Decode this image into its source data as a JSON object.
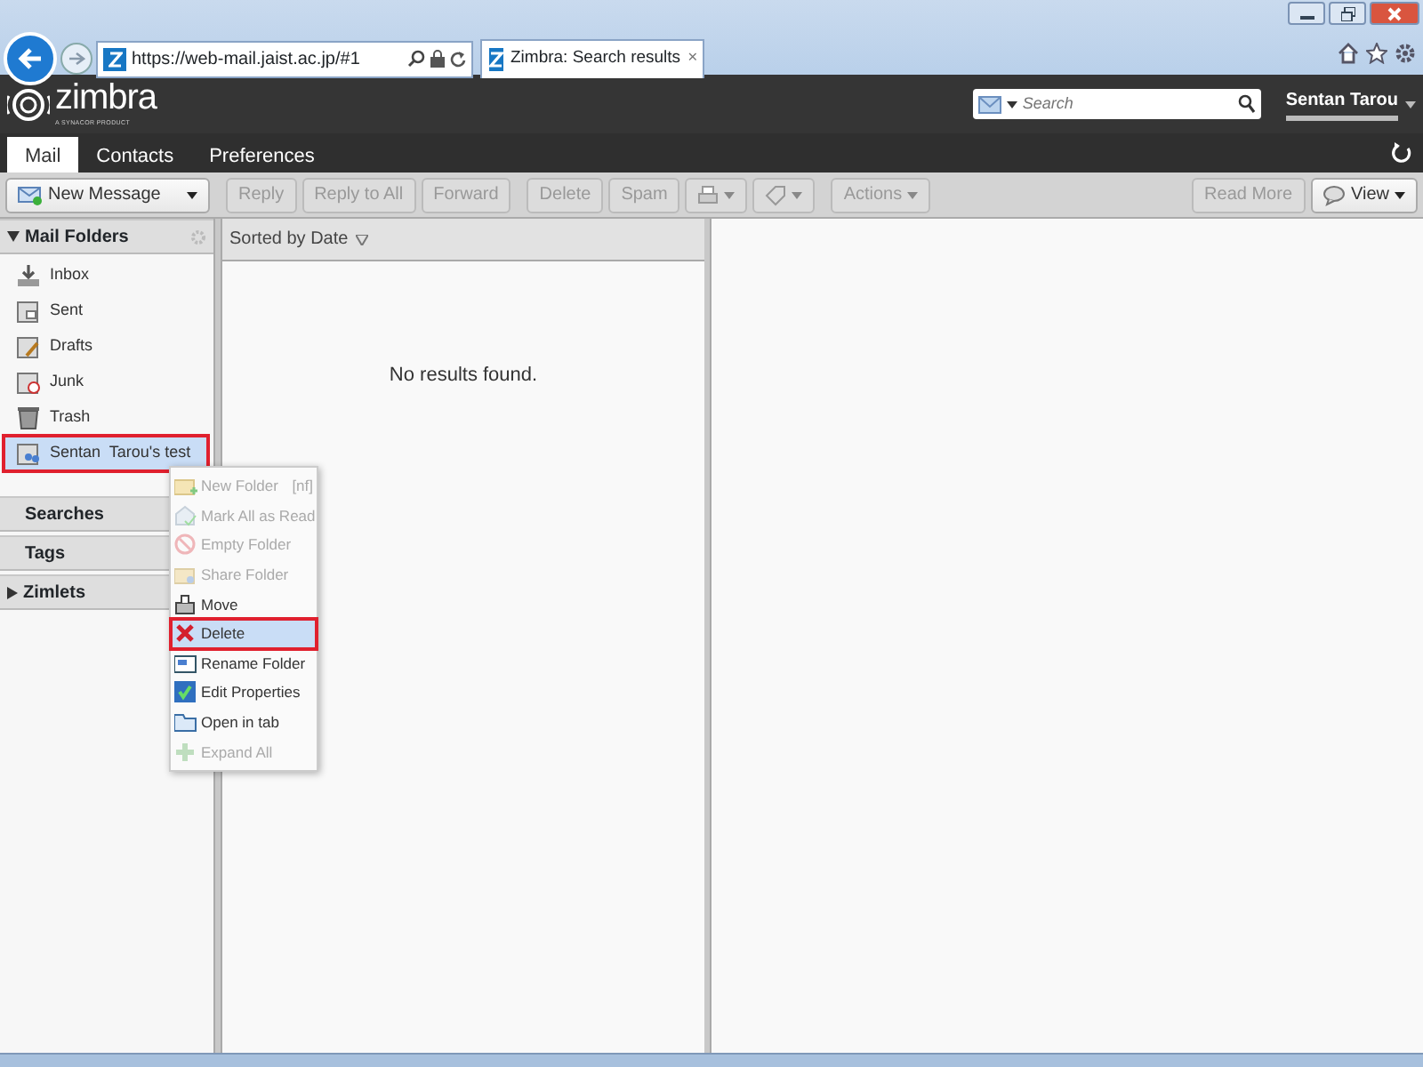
{
  "browser": {
    "address": "https://web-mail.jaist.ac.jp/#1",
    "tab_title": "Zimbra: Search results",
    "tab_close": "×"
  },
  "header": {
    "logo": "zimbra",
    "logo_sub": "A SYNACOR PRODUCT",
    "search_placeholder": "Search",
    "user": "Sentan Tarou"
  },
  "app_tabs": [
    {
      "label": "Mail",
      "selected": true
    },
    {
      "label": "Contacts",
      "selected": false
    },
    {
      "label": "Preferences",
      "selected": false
    }
  ],
  "toolbar": {
    "left": [
      {
        "label": "New Message",
        "kind": "menu",
        "disabled": false
      },
      {
        "label": "Reply",
        "kind": "plain",
        "disabled": true
      },
      {
        "label": "Reply to All",
        "kind": "plain",
        "disabled": true
      },
      {
        "label": "Forward",
        "kind": "plain",
        "disabled": true
      },
      {
        "label": "Delete",
        "kind": "plain",
        "disabled": true
      },
      {
        "label": "Spam",
        "kind": "plain",
        "disabled": true
      },
      {
        "kind": "iconmenu",
        "disabled": true
      },
      {
        "kind": "iconmenu",
        "disabled": true
      },
      {
        "label": "Actions",
        "kind": "menu",
        "disabled": true
      }
    ],
    "right": [
      {
        "label": "Read More",
        "kind": "plain",
        "disabled": true
      },
      {
        "label": "View",
        "kind": "menu",
        "disabled": false
      }
    ]
  },
  "sidebar": {
    "sections": [
      {
        "title": "Mail Folders",
        "expanded": true,
        "folders": [
          {
            "label": "Inbox",
            "selected": false
          },
          {
            "label": "Sent",
            "selected": false
          },
          {
            "label": "Drafts",
            "selected": false
          },
          {
            "label": "Junk",
            "selected": false
          },
          {
            "label": "Trash",
            "selected": false
          },
          {
            "label": "Sentan  Tarou's test",
            "selected": true
          }
        ]
      },
      {
        "title": "Searches"
      },
      {
        "title": "Tags"
      },
      {
        "title": "Zimlets",
        "expanded": false
      }
    ]
  },
  "list": {
    "sort_label": "Sorted by Date",
    "empty_message": "No results found."
  },
  "context_menu": [
    {
      "label": "New Folder",
      "shortcut": "[nf]",
      "disabled": true,
      "highlighted": false
    },
    {
      "label": "Mark All as Read",
      "disabled": true,
      "highlighted": false
    },
    {
      "label": "Empty Folder",
      "disabled": true,
      "highlighted": false
    },
    {
      "label": "Share Folder",
      "disabled": true,
      "highlighted": false
    },
    {
      "label": "Move",
      "disabled": false,
      "highlighted": false
    },
    {
      "label": "Delete",
      "disabled": false,
      "highlighted": true
    },
    {
      "label": "Rename Folder",
      "disabled": false,
      "highlighted": false
    },
    {
      "label": "Edit Properties",
      "disabled": false,
      "highlighted": false
    },
    {
      "label": "Open in tab",
      "disabled": false,
      "highlighted": false
    },
    {
      "label": "Expand All",
      "disabled": true,
      "highlighted": false
    }
  ]
}
